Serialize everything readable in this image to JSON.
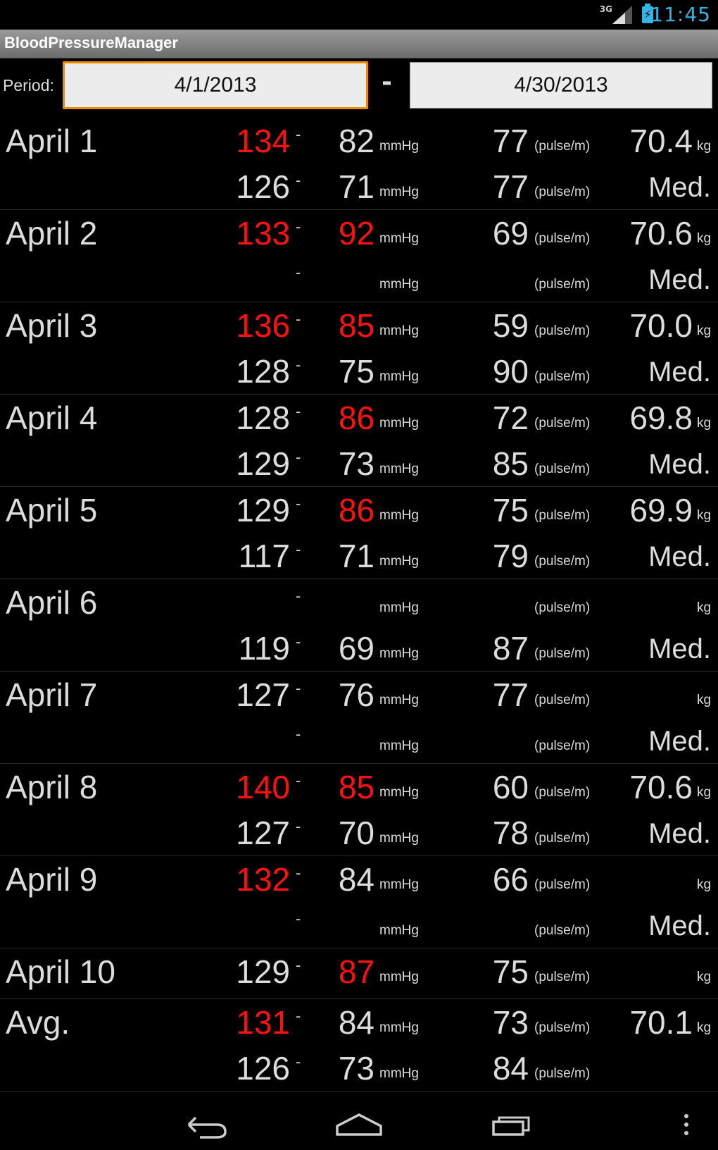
{
  "status_bar": {
    "time": "11:45",
    "network_label": "3G",
    "icons": [
      "signal-icon",
      "battery-charging-icon"
    ],
    "accent_color": "#33b5e5"
  },
  "action_bar": {
    "title": "BloodPressureManager"
  },
  "period": {
    "label": "Period:",
    "start": "4/1/2013",
    "separator": "-",
    "end": "4/30/2013"
  },
  "units": {
    "mmhg": "mmHg",
    "pulse": "(pulse/m)",
    "kg": "kg",
    "med": "Med.",
    "dash": "-"
  },
  "colors": {
    "alert": "#ff1010",
    "normal": "#dcdcdc",
    "focus_border": "#f08c00"
  },
  "records": [
    {
      "date": "April 1",
      "lines": [
        {
          "sys": "134",
          "sys_alert": true,
          "dia": "82",
          "dia_alert": false,
          "pulse": "77",
          "weight": "70.4"
        },
        {
          "sys": "126",
          "sys_alert": false,
          "dia": "71",
          "dia_alert": false,
          "pulse": "77",
          "med": true
        }
      ]
    },
    {
      "date": "April 2",
      "lines": [
        {
          "sys": "133",
          "sys_alert": true,
          "dia": "92",
          "dia_alert": true,
          "pulse": "69",
          "weight": "70.6"
        },
        {
          "sys": "",
          "dia": "",
          "pulse": "",
          "med": true
        }
      ]
    },
    {
      "date": "April 3",
      "lines": [
        {
          "sys": "136",
          "sys_alert": true,
          "dia": "85",
          "dia_alert": true,
          "pulse": "59",
          "weight": "70.0"
        },
        {
          "sys": "128",
          "dia": "75",
          "pulse": "90",
          "med": true
        }
      ]
    },
    {
      "date": "April 4",
      "lines": [
        {
          "sys": "128",
          "dia": "86",
          "dia_alert": true,
          "pulse": "72",
          "weight": "69.8"
        },
        {
          "sys": "129",
          "dia": "73",
          "pulse": "85",
          "med": true
        }
      ]
    },
    {
      "date": "April 5",
      "lines": [
        {
          "sys": "129",
          "dia": "86",
          "dia_alert": true,
          "pulse": "75",
          "weight": "69.9"
        },
        {
          "sys": "117",
          "dia": "71",
          "pulse": "79",
          "med": true
        }
      ]
    },
    {
      "date": "April 6",
      "lines": [
        {
          "sys": "",
          "dia": "",
          "pulse": "",
          "weight": ""
        },
        {
          "sys": "119",
          "dia": "69",
          "pulse": "87",
          "med": true
        }
      ]
    },
    {
      "date": "April 7",
      "lines": [
        {
          "sys": "127",
          "dia": "76",
          "pulse": "77",
          "weight": ""
        },
        {
          "sys": "",
          "dia": "",
          "pulse": "",
          "med": true
        }
      ]
    },
    {
      "date": "April 8",
      "lines": [
        {
          "sys": "140",
          "sys_alert": true,
          "dia": "85",
          "dia_alert": true,
          "pulse": "60",
          "weight": "70.6"
        },
        {
          "sys": "127",
          "dia": "70",
          "pulse": "78",
          "med": true
        }
      ]
    },
    {
      "date": "April 9",
      "lines": [
        {
          "sys": "132",
          "sys_alert": true,
          "dia": "84",
          "pulse": "66",
          "weight": ""
        },
        {
          "sys": "",
          "dia": "",
          "pulse": "",
          "med": true
        }
      ]
    },
    {
      "date": "April 10",
      "lines": [
        {
          "sys": "129",
          "dia": "87",
          "dia_alert": true,
          "pulse": "75",
          "weight": ""
        }
      ]
    },
    {
      "date": "Avg.",
      "lines": [
        {
          "sys": "131",
          "sys_alert": true,
          "dia": "84",
          "pulse": "73",
          "weight": "70.1"
        },
        {
          "sys": "126",
          "dia": "73",
          "pulse": "84",
          "no_right": true
        }
      ]
    }
  ],
  "nav_bar": {
    "buttons": [
      "back-icon",
      "home-icon",
      "recent-apps-icon",
      "overflow-menu-icon"
    ]
  }
}
